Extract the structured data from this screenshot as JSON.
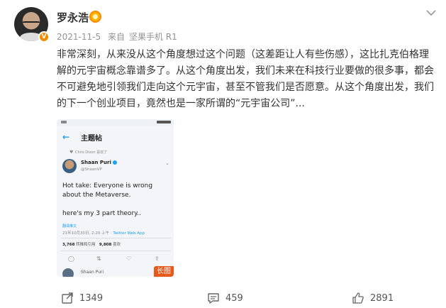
{
  "author": {
    "name": "罗永浩",
    "verified": true,
    "badge_color": "#f28b00"
  },
  "meta": {
    "date": "2021-11-5",
    "source_prefix": "来自",
    "source": "坚果手机 R1"
  },
  "content": {
    "text": "非常深刻，从来没从这个角度想过这个问题（这差距让人有些伤感），这比扎克伯格理解的元宇宙概念靠谱多了。从这个角度出发，我们未来在科技行业要做的很多事，都会不可避免地引领我们走向这个元宇宙，甚至不管我们是否愿意。从这个角度出发，我们的下一个创业项目，竟然也是一家所谓的“元宇宙公司”..."
  },
  "media": {
    "header_title": "主题帖",
    "liked_by": "Chris Dixon 喜欢了",
    "tweet_author": "Shaan Puri",
    "tweet_handle": "@ShaanVP",
    "tweet_text": "Hot take: Everyone is wrong about the Metaverse.",
    "tweet_text_2": "here's my 3 part theory..",
    "translate_label": "翻译推文",
    "tweet_date": "21年10月30日, 2:20 上午",
    "tweet_source": "Twitter Web App",
    "retweets_count": "3,768",
    "retweets_label": "转推和引用",
    "likes_count": "9,808",
    "likes_label": "喜欢",
    "next_author": "Shaan Puri",
    "long_image_tag": "长图"
  },
  "actions": {
    "repost_count": "1349",
    "comment_count": "459",
    "like_count": "2891"
  },
  "colors": {
    "link_blue": "#1da1f2",
    "tag_orange": "#e8591c",
    "meta_gray": "#939393"
  }
}
